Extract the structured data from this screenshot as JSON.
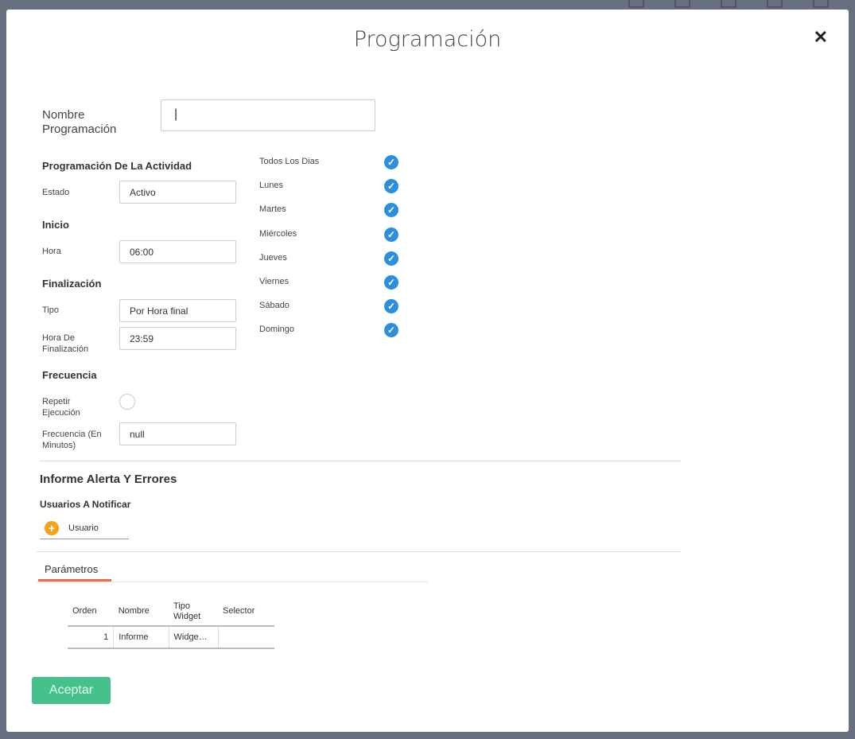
{
  "title": "Programación",
  "close": "✕",
  "nombre_label": "Nombre Programación",
  "nombre_value": "",
  "actividad_heading": "Programación De La Actividad",
  "estado_label": "Estado",
  "estado_value": "Activo",
  "inicio_heading": "Inicio",
  "hora_label": "Hora",
  "hora_value": "06:00",
  "fin_heading": "Finalización",
  "tipo_label": "Tipo",
  "tipo_value": "Por Hora final",
  "hora_fin_label": "Hora De Finalización",
  "hora_fin_value": "23:59",
  "frecuencia_heading": "Frecuencia",
  "repetir_label": "Repetir Ejecución",
  "frec_label": "Frecuencia (En Minutos)",
  "frec_value": "null",
  "days": [
    {
      "label": "Todos Los Dias",
      "checked": true
    },
    {
      "label": "Lunes",
      "checked": true
    },
    {
      "label": "Martes",
      "checked": true
    },
    {
      "label": "Miércoles",
      "checked": true
    },
    {
      "label": "Jueves",
      "checked": true
    },
    {
      "label": "Viernes",
      "checked": true
    },
    {
      "label": "Sábado",
      "checked": true
    },
    {
      "label": "Domingo",
      "checked": true
    }
  ],
  "informe_heading": "Informe Alerta Y Errores",
  "usuarios_heading": "Usuarios A Notificar",
  "usuario_button": "Usuario",
  "tab": "Parámetros",
  "table": {
    "headers": [
      "Orden",
      "Nombre",
      "Tipo Widget",
      "Selector"
    ],
    "rows": [
      [
        "1",
        "Informe",
        "Widge…",
        ""
      ]
    ]
  },
  "accept": "Aceptar"
}
